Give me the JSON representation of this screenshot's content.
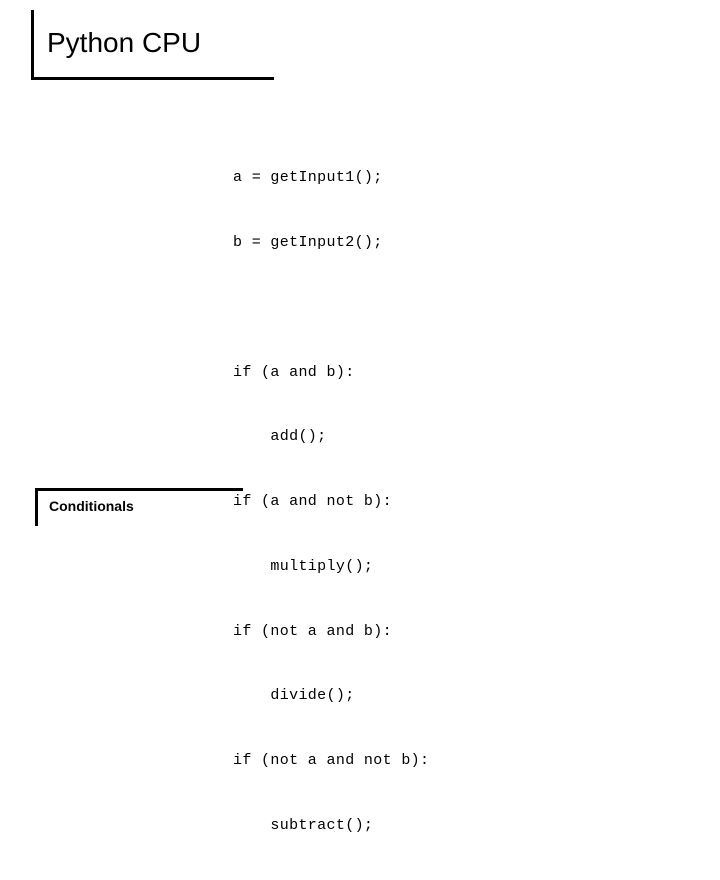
{
  "slide": {
    "title": "Python CPU",
    "footer_label": "Conditionals",
    "colors": {
      "background": "#ffffff",
      "foreground": "#000000",
      "rule": "#000000"
    }
  },
  "code": {
    "language": "python",
    "lines": [
      "a = getInput1();",
      "b = getInput2();",
      "",
      "if (a and b):",
      "    add();",
      "if (a and not b):",
      "    multiply();",
      "if (not a and b):",
      "    divide();",
      "if (not a and not b):",
      "    subtract();"
    ]
  }
}
